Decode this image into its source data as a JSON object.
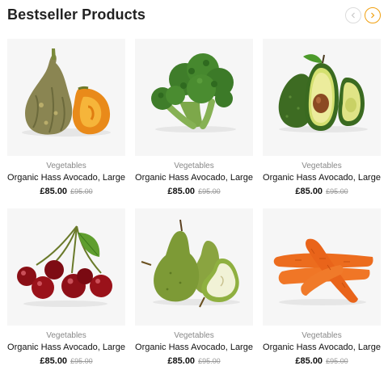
{
  "section": {
    "title": "Bestseller Products",
    "prev_icon": "chevron-left-icon",
    "next_icon": "chevron-right-icon",
    "accent_color": "#f0a010"
  },
  "products": [
    {
      "image": "pumpkin-squash-image",
      "category": "Vegetables",
      "name": "Organic Hass Avocado, Large",
      "price": "£85.00",
      "old_price": "£95.00"
    },
    {
      "image": "broccoli-image",
      "category": "Vegetables",
      "name": "Organic Hass Avocado, Large",
      "price": "£85.00",
      "old_price": "£95.00"
    },
    {
      "image": "avocado-image",
      "category": "Vegetables",
      "name": "Organic Hass Avocado, Large",
      "price": "£85.00",
      "old_price": "£95.00"
    },
    {
      "image": "cherries-image",
      "category": "Vegetables",
      "name": "Organic Hass Avocado, Large",
      "price": "£85.00",
      "old_price": "£95.00"
    },
    {
      "image": "pears-image",
      "category": "Vegetables",
      "name": "Organic Hass Avocado, Large",
      "price": "£85.00",
      "old_price": "£95.00"
    },
    {
      "image": "carrots-image",
      "category": "Vegetables",
      "name": "Organic Hass Avocado, Large",
      "price": "£85.00",
      "old_price": "£95.00"
    }
  ]
}
